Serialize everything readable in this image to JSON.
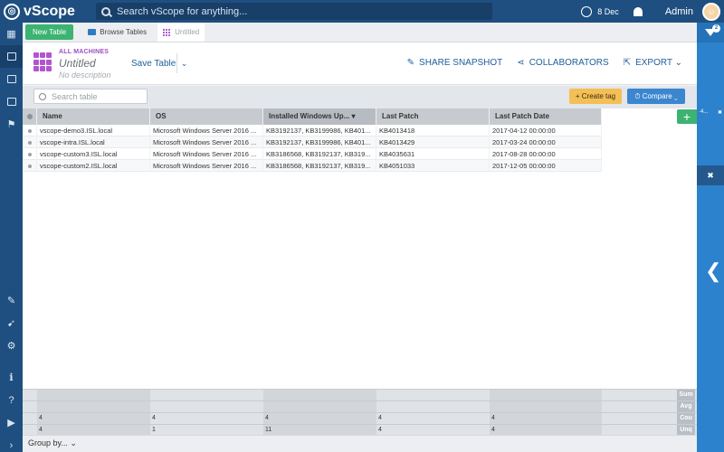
{
  "app": {
    "logo": "vScope",
    "logo_mark": "◎"
  },
  "topbar": {
    "search_placeholder": "Search vScope for anything...",
    "date": "8 Dec",
    "user": "Admin",
    "avatar": "☺"
  },
  "tabs": {
    "new_table": "New Table",
    "browse": "Browse Tables",
    "current": "Untitled"
  },
  "header": {
    "category": "ALL MACHINES",
    "title": "Untitled",
    "description": "No description",
    "save": "Save Table",
    "save_caret": "⌄",
    "actions": [
      {
        "icon": "✎",
        "label": "SHARE SNAPSHOT"
      },
      {
        "icon": "⋖",
        "label": "COLLABORATORS"
      },
      {
        "icon": "⇱",
        "label": "EXPORT ⌄"
      }
    ]
  },
  "toolbar": {
    "search_placeholder": "Search table",
    "create_tag": "+ Create tag",
    "compare": "⏱ Compare ⌄"
  },
  "table": {
    "columns": [
      "Name",
      "OS",
      "Installed Windows Up...  ▾",
      "Last Patch",
      "Last Patch Date"
    ],
    "rows": [
      [
        "vscope-demo3.ISL.local",
        "Microsoft Windows Server 2016 ...",
        "KB3192137, KB3199986, KB401...",
        "KB4013418",
        "2017-04-12 00:00:00"
      ],
      [
        "vscope-intra.ISL.local",
        "Microsoft Windows Server 2016 ...",
        "KB3192137, KB3199986, KB401...",
        "KB4013429",
        "2017-03-24 00:00:00"
      ],
      [
        "vscope-custom3.ISL.local",
        "Microsoft Windows Server 2016 ...",
        "KB3186568, KB3192137, KB319...",
        "KB4035631",
        "2017-08-28 00:00:00"
      ],
      [
        "vscope-custom2.ISL.local",
        "Microsoft Windows Server 2016 ...",
        "KB3186568, KB3192137, KB319...",
        "KB4051033",
        "2017-12-05 00:00:00"
      ]
    ]
  },
  "aggregates": {
    "labels": [
      "Sum",
      "Avg",
      "Cou",
      "Unq"
    ],
    "count": [
      "4",
      "4",
      "4",
      "4",
      "4"
    ],
    "unique": [
      "4",
      "1",
      "11",
      "4",
      "4"
    ]
  },
  "footer": {
    "group_by": "Group by... ⌄"
  },
  "rightpanel": {
    "badge": "2",
    "chip_left": "·4...",
    "chip_close": "✖",
    "panel_close": "✖",
    "collapse": "❮"
  },
  "colors": {
    "navy": "#1f4f80",
    "green": "#3cb371",
    "blue": "#2c82cc",
    "purple": "#b255d0",
    "yellow": "#f4bf56"
  }
}
